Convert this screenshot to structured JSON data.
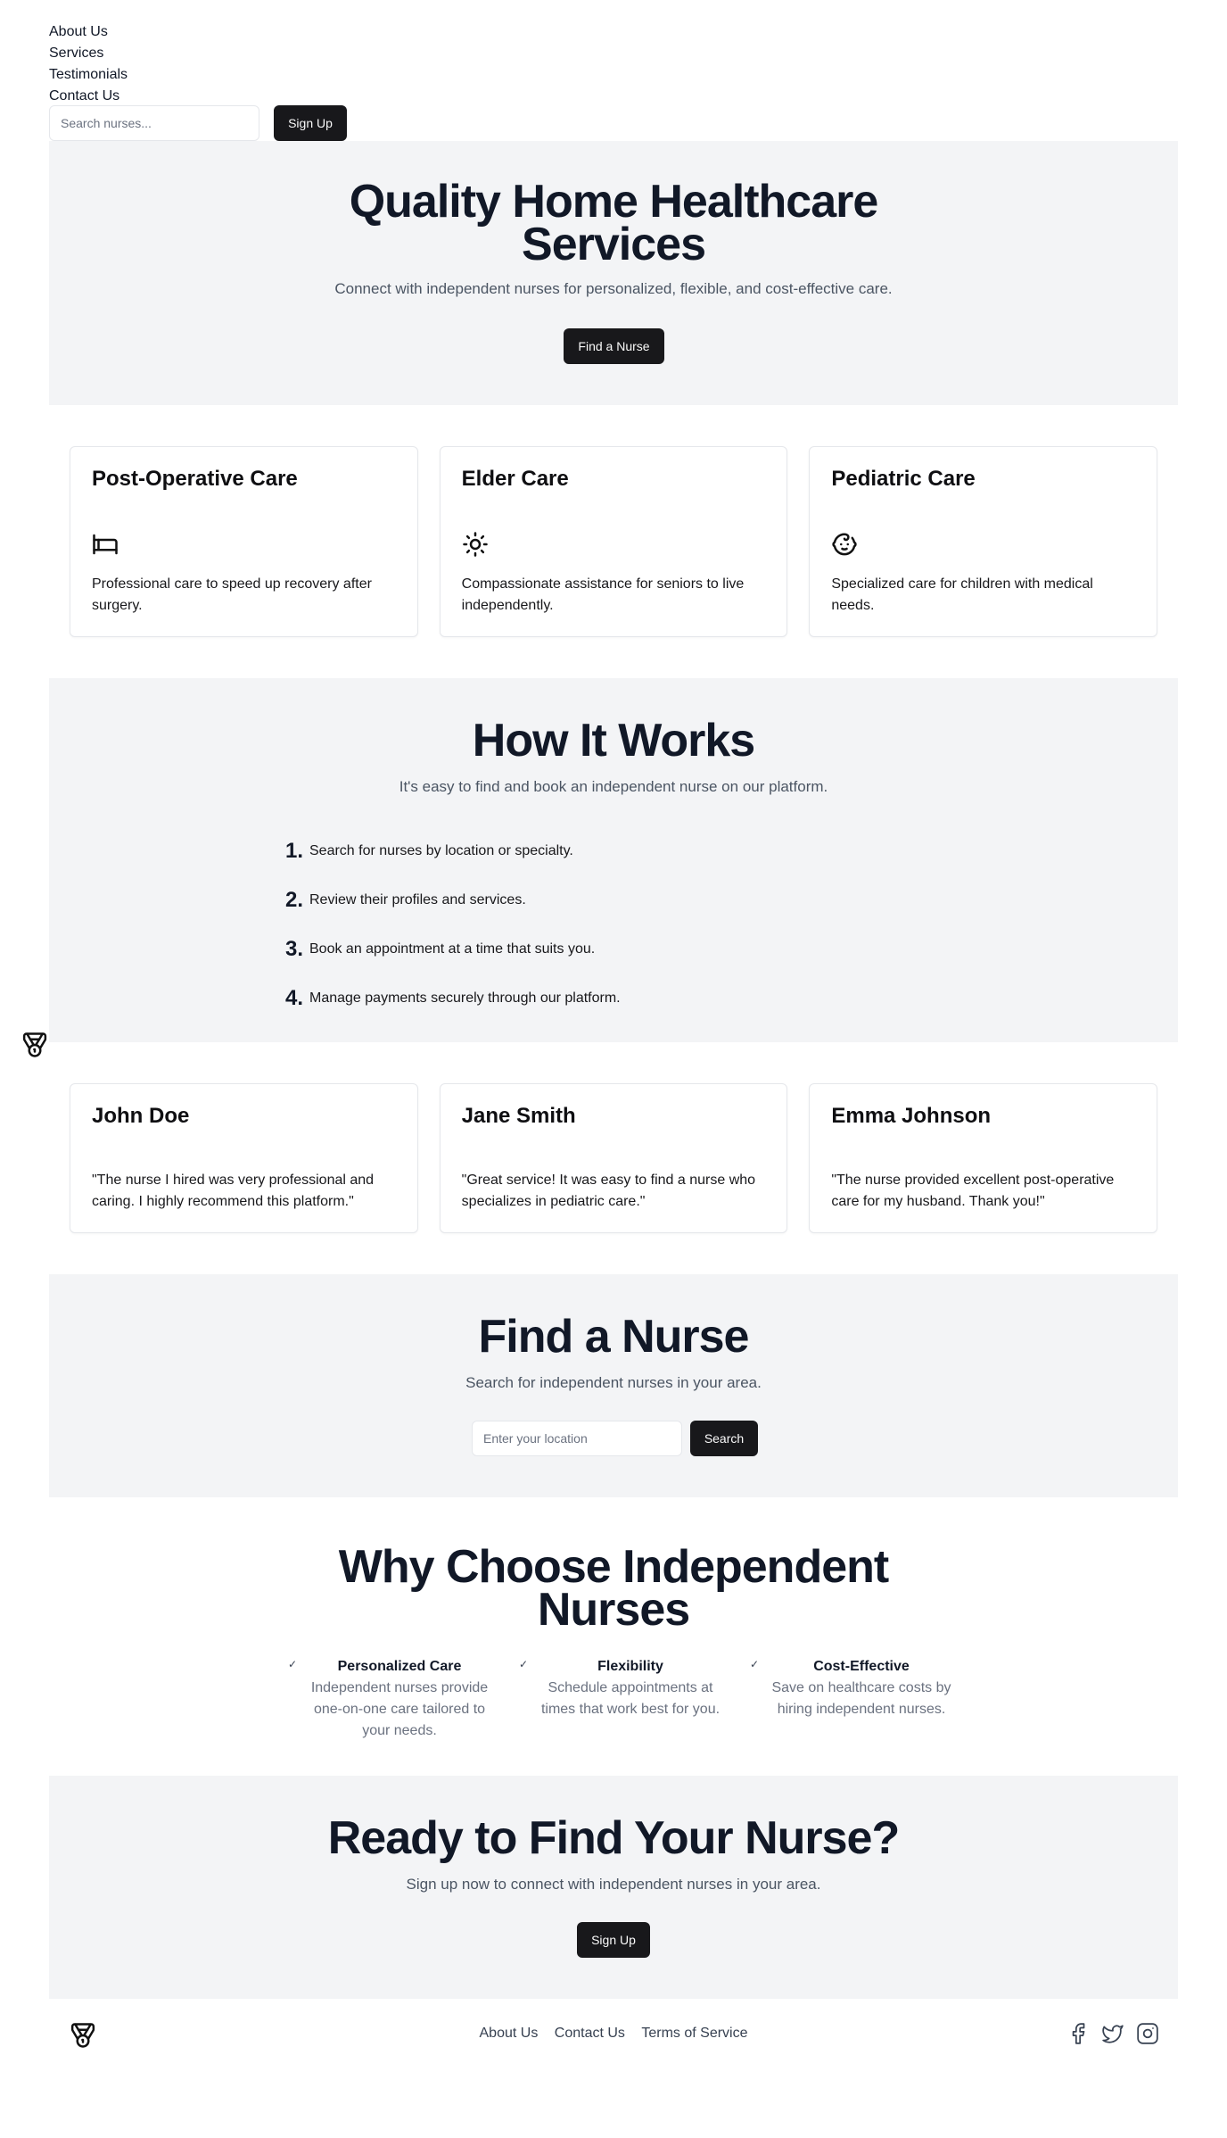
{
  "nav": {
    "items": [
      "About Us",
      "Services",
      "Testimonials",
      "Contact Us"
    ]
  },
  "header": {
    "search_placeholder": "Search nurses...",
    "signup_label": "Sign Up"
  },
  "hero": {
    "title_line1": "Quality Home Healthcare",
    "title_line2": "Services",
    "subtitle": "Connect with independent nurses for personalized, flexible, and cost-effective care.",
    "cta_label": "Find a Nurse"
  },
  "services": [
    {
      "title": "Post-Operative Care",
      "icon": "bed-icon",
      "description": "Professional care to speed up recovery after surgery."
    },
    {
      "title": "Elder Care",
      "icon": "sun-icon",
      "description": "Compassionate assistance for seniors to live independently."
    },
    {
      "title": "Pediatric Care",
      "icon": "baby-icon",
      "description": "Specialized care for children with medical needs."
    }
  ],
  "how": {
    "title": "How It Works",
    "subtitle": "It's easy to find and book an independent nurse on our platform.",
    "steps": [
      {
        "num": "1.",
        "text": "Search for nurses by location or specialty."
      },
      {
        "num": "2.",
        "text": "Review their profiles and services."
      },
      {
        "num": "3.",
        "text": "Book an appointment at a time that suits you."
      },
      {
        "num": "4.",
        "text": "Manage payments securely through our platform."
      }
    ]
  },
  "testimonials": [
    {
      "name": "John Doe",
      "quote": "\"The nurse I hired was very professional and caring. I highly recommend this platform.\""
    },
    {
      "name": "Jane Smith",
      "quote": "\"Great service! It was easy to find a nurse who specializes in pediatric care.\""
    },
    {
      "name": "Emma Johnson",
      "quote": "\"The nurse provided excellent post-operative care for my husband. Thank you!\""
    }
  ],
  "find": {
    "title": "Find a Nurse",
    "subtitle": "Search for independent nurses in your area.",
    "placeholder": "Enter your location",
    "button_label": "Search"
  },
  "why": {
    "title_line1": "Why Choose Independent",
    "title_line2": "Nurses",
    "check": "✓",
    "features": [
      {
        "title": "Personalized Care",
        "description": "Independent nurses provide one-on-one care tailored to your needs."
      },
      {
        "title": "Flexibility",
        "description": "Schedule appointments at times that work best for you."
      },
      {
        "title": "Cost-Effective",
        "description": "Save on healthcare costs by hiring independent nurses."
      }
    ]
  },
  "cta": {
    "title": "Ready to Find Your Nurse?",
    "subtitle": "Sign up now to connect with independent nurses in your area.",
    "button_label": "Sign Up"
  },
  "footer": {
    "links": [
      "About Us",
      "Contact Us",
      "Terms of Service"
    ],
    "socials": [
      "facebook-icon",
      "twitter-icon",
      "instagram-icon"
    ],
    "logo_icon": "medal-icon"
  }
}
